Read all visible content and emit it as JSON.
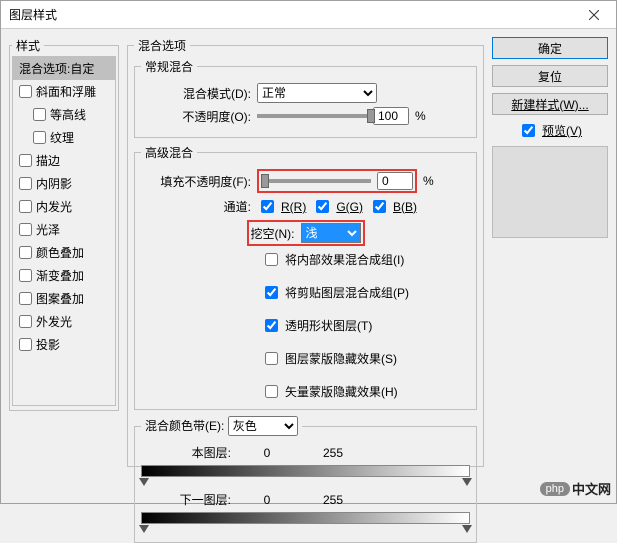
{
  "window": {
    "title": "图层样式"
  },
  "left": {
    "legend": "样式",
    "items": [
      {
        "label": "混合选项:自定",
        "sel": true,
        "checkbox": false
      },
      {
        "label": "斜面和浮雕",
        "sel": false,
        "checkbox": true,
        "checked": false
      },
      {
        "label": "等高线",
        "sel": false,
        "checkbox": true,
        "checked": false,
        "sub": true
      },
      {
        "label": "纹理",
        "sel": false,
        "checkbox": true,
        "checked": false,
        "sub": true
      },
      {
        "label": "描边",
        "sel": false,
        "checkbox": true,
        "checked": false
      },
      {
        "label": "内阴影",
        "sel": false,
        "checkbox": true,
        "checked": false
      },
      {
        "label": "内发光",
        "sel": false,
        "checkbox": true,
        "checked": false
      },
      {
        "label": "光泽",
        "sel": false,
        "checkbox": true,
        "checked": false
      },
      {
        "label": "颜色叠加",
        "sel": false,
        "checkbox": true,
        "checked": false
      },
      {
        "label": "渐变叠加",
        "sel": false,
        "checkbox": true,
        "checked": false
      },
      {
        "label": "图案叠加",
        "sel": false,
        "checkbox": true,
        "checked": false
      },
      {
        "label": "外发光",
        "sel": false,
        "checkbox": true,
        "checked": false
      },
      {
        "label": "投影",
        "sel": false,
        "checkbox": true,
        "checked": false
      }
    ]
  },
  "center": {
    "blendOptionsLegend": "混合选项",
    "generalLegend": "常规混合",
    "blendModeLabel": "混合模式(D):",
    "blendModeValue": "正常",
    "opacityLabel": "不透明度(O):",
    "opacityValue": "100",
    "percent": "%",
    "advancedLegend": "高级混合",
    "fillOpacityLabel": "填充不透明度(F):",
    "fillOpacityValue": "0",
    "channelsLabel": "通道:",
    "chR": "R(R)",
    "chG": "G(G)",
    "chB": "B(B)",
    "knockoutLabel": "挖空(N):",
    "knockoutValue": "浅",
    "opt1": "将内部效果混合成组(I)",
    "opt2": "将剪贴图层混合成组(P)",
    "opt3": "透明形状图层(T)",
    "opt4": "图层蒙版隐藏效果(S)",
    "opt5": "矢量蒙版隐藏效果(H)",
    "blendIfLegend": "混合颜色带(E):",
    "blendIfValue": "灰色",
    "thisLayerLabel": "本图层:",
    "thisLow": "0",
    "thisHigh": "255",
    "underLayerLabel": "下一图层:",
    "underLow": "0",
    "underHigh": "255"
  },
  "right": {
    "ok": "确定",
    "cancel": "复位",
    "newStyle": "新建样式(W)...",
    "previewLabel": "预览(V)"
  },
  "watermark": {
    "badge": "php",
    "text": "中文网"
  }
}
